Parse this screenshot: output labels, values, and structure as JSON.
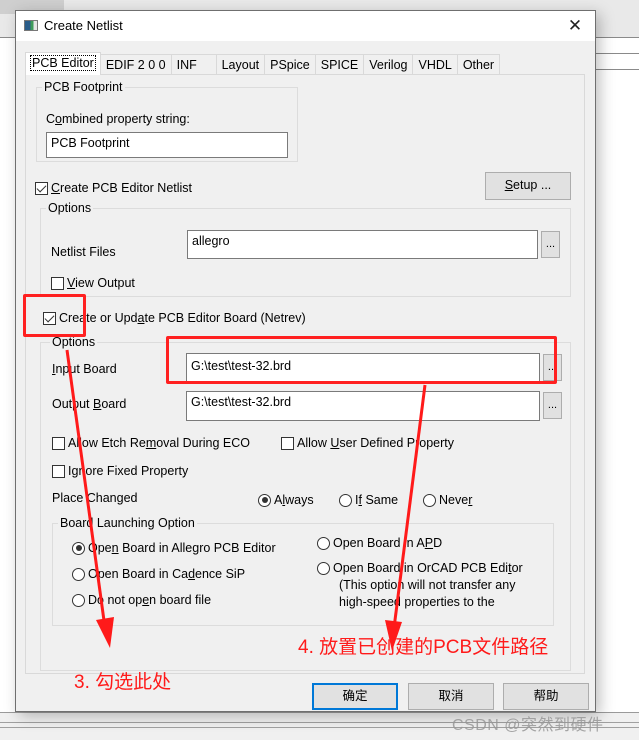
{
  "dialog": {
    "title": "Create Netlist",
    "close_icon": "close-icon"
  },
  "tabs": [
    {
      "label": "PCB Editor",
      "active": true
    },
    {
      "label": "EDIF 2 0 0",
      "active": false
    },
    {
      "label": "INF",
      "active": false
    },
    {
      "label": "Layout",
      "active": false
    },
    {
      "label": "PSpice",
      "active": false
    },
    {
      "label": "SPICE",
      "active": false
    },
    {
      "label": "Verilog",
      "active": false
    },
    {
      "label": "VHDL",
      "active": false
    },
    {
      "label": "Other",
      "active": false
    }
  ],
  "pcb_footprint": {
    "group_label": "PCB Footprint",
    "combined_label_pre": "C",
    "combined_label_ul": "o",
    "combined_label_post": "mbined property string:",
    "value": "PCB Footprint"
  },
  "create_netlist": {
    "checked": true,
    "label_ul": "C",
    "label_post": "reate PCB Editor Netlist",
    "setup_ul": "S",
    "setup_post": "etup ..."
  },
  "netlist_options": {
    "group_label": "Options",
    "netlist_files_label": "Netlist Files",
    "netlist_files_value": "allegro",
    "browse_label": "...",
    "view_output_checked": false,
    "view_output_ul": "V",
    "view_output_post": "iew Output"
  },
  "netrev": {
    "checked": true,
    "label_pre": "Create or Upd",
    "label_ul": "a",
    "label_post": "te PCB Editor Board (Netrev)"
  },
  "board_options": {
    "group_label": "Options",
    "input_board_ul": "I",
    "input_board_post": "nput Board",
    "input_board_value": "G:\\test\\test-32.brd",
    "output_board_pre": "Output ",
    "output_board_ul": "B",
    "output_board_post": "oard",
    "output_board_value": "G:\\test\\test-32.brd",
    "browse_label": "...",
    "allow_etch": {
      "checked": false,
      "pre": "Allow Etch Re",
      "ul": "m",
      "post": "oval During ECO"
    },
    "allow_user": {
      "checked": false,
      "pre": "Allow ",
      "ul": "U",
      "post": "ser Defined Property"
    },
    "ignore_fixed": {
      "checked": false,
      "pre": "I",
      "ul": "g",
      "post": "nore Fixed Property"
    },
    "place_changed_label": "Place Changed",
    "place_changed_options": [
      {
        "pre": "A",
        "ul": "l",
        "post": "ways",
        "selected": true
      },
      {
        "pre": "I",
        "ul": "f",
        "post": " Same",
        "selected": false
      },
      {
        "pre": "Neve",
        "ul": "r",
        "post": "",
        "selected": false
      }
    ]
  },
  "launching": {
    "group_label": "Board Launching Option",
    "options": [
      {
        "pre": "Ope",
        "ul": "n",
        "post": " Board in Allegro PCB Editor",
        "selected": true
      },
      {
        "pre": "Open Board in Ca",
        "ul": "d",
        "post": "ence SiP",
        "selected": false
      },
      {
        "pre": "Do not op",
        "ul": "e",
        "post": "n board file",
        "selected": false
      },
      {
        "pre": "Open Board in A",
        "ul": "P",
        "post": "D",
        "selected": false
      },
      {
        "pre": "Open Board in OrCAD PCB Edi",
        "ul": "t",
        "post": "or",
        "selected": false
      }
    ],
    "orcad_note_line1": "(This option will not transfer any",
    "orcad_note_line2": "high-speed properties to the"
  },
  "buttons": {
    "ok": "确定",
    "cancel": "取消",
    "help": "帮助"
  },
  "annotations": {
    "step3": "3. 勾选此处",
    "step4": "4. 放置已创建的PCB文件路径",
    "color": "#ff1a1a"
  },
  "watermark": "CSDN @突然到硬件"
}
